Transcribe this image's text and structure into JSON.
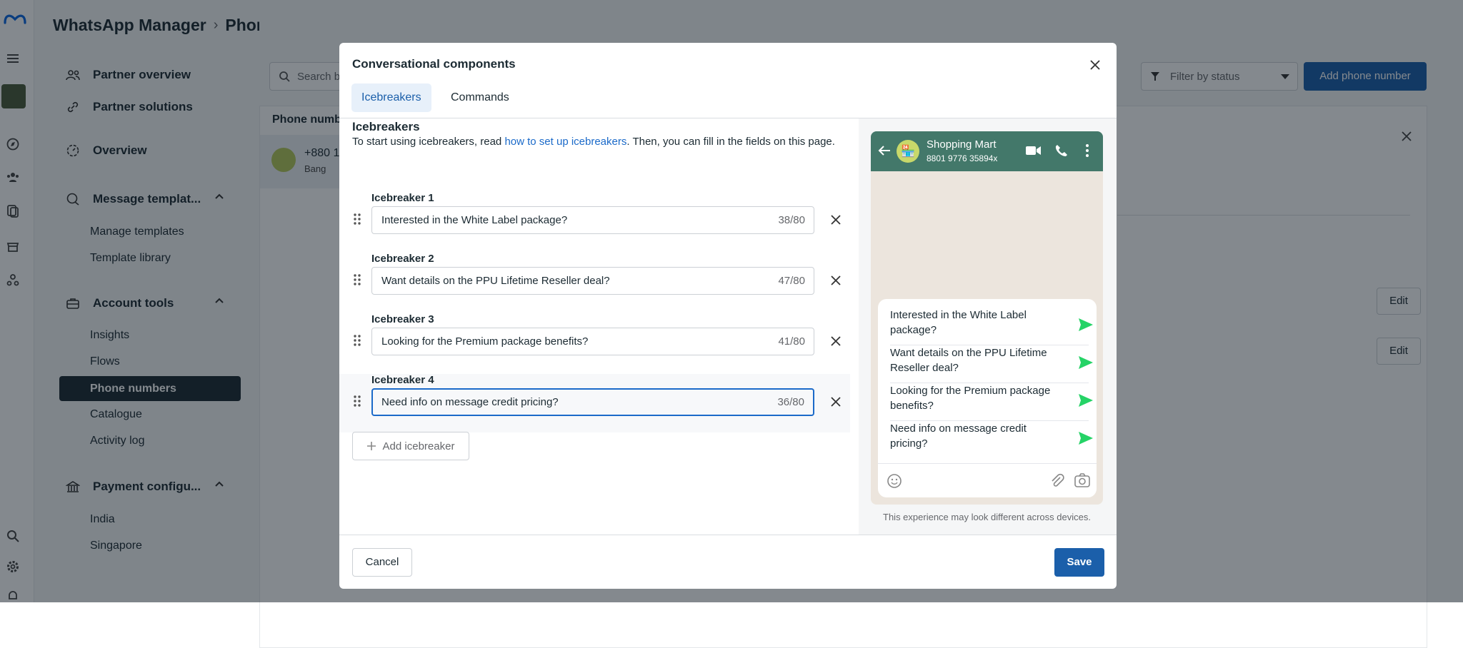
{
  "breadcrumb": {
    "root": "WhatsApp Manager",
    "current": "Phone numbers"
  },
  "sidebar": {
    "partner_overview": "Partner overview",
    "partner_solutions": "Partner solutions",
    "overview": "Overview",
    "message_templates": "Message templat...",
    "manage_templates": "Manage templates",
    "template_library": "Template library",
    "account_tools": "Account tools",
    "insights": "Insights",
    "flows": "Flows",
    "phone_numbers": "Phone numbers",
    "catalogue": "Catalogue",
    "activity_log": "Activity log",
    "payment_config": "Payment configu...",
    "india": "India",
    "singapore": "Singapore"
  },
  "background": {
    "search_placeholder": "Search b",
    "filter_status": "Filter by status",
    "add_phone": "Add phone number",
    "phone_col": "Phone numb",
    "phone_row": "+880 1",
    "phone_region": "Bang",
    "edit1": "Edit",
    "edit2": "Edit"
  },
  "modal": {
    "title": "Conversational components",
    "tabs": [
      "Icebreakers",
      "Commands"
    ],
    "section_title": "Icebreakers",
    "desc_pre": "To start using icebreakers, read ",
    "desc_link": "how to set up icebreakers",
    "desc_post": ". Then, you can fill in the fields on this page.",
    "icebreakers": [
      {
        "label": "Icebreaker 1",
        "value": "Interested in the White Label package?",
        "count": "38/80"
      },
      {
        "label": "Icebreaker 2",
        "value": "Want details on the PPU Lifetime Reseller deal?",
        "count": "47/80"
      },
      {
        "label": "Icebreaker 3",
        "value": "Looking for the Premium package benefits?",
        "count": "41/80"
      },
      {
        "label": "Icebreaker 4",
        "value": "Need info on message credit pricing?",
        "count": "36/80"
      }
    ],
    "add_label": "Add icebreaker",
    "cancel": "Cancel",
    "save": "Save"
  },
  "preview": {
    "contact_name": "Shopping Mart",
    "contact_number": "8801 9776 35894x",
    "items": [
      "Interested in the White Label package?",
      "Want details on the PPU Lifetime Reseller deal?",
      "Looking for the Premium package benefits?",
      "Need info on message credit pricing?"
    ],
    "disclaimer": "This experience may look different across devices."
  },
  "colors": {
    "accent": "#1b5faa",
    "wa_header": "#43786a",
    "send": "#25d366"
  }
}
